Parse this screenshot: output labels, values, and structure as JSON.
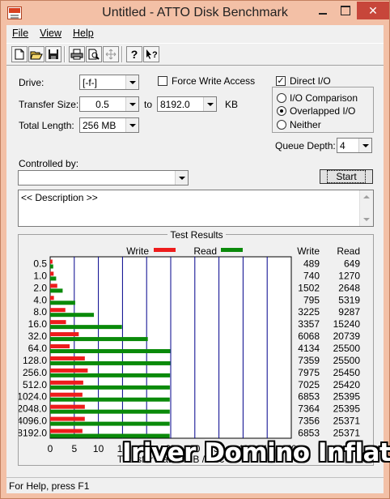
{
  "window": {
    "title": "Untitled - ATTO Disk Benchmark",
    "close_glyph": "✕"
  },
  "menu": [
    "File",
    "View",
    "Help"
  ],
  "toolbar_icons": [
    "new-icon",
    "open-icon",
    "save-icon",
    "print-icon",
    "print-preview-icon",
    "move-icon",
    "help-icon",
    "context-help-icon"
  ],
  "settings": {
    "drive_label": "Drive:",
    "drive_value": "[-f-]",
    "force_write_label": "Force Write Access",
    "force_write_checked": false,
    "direct_io_label": "Direct I/O",
    "direct_io_checked": true,
    "transfer_size_label": "Transfer Size:",
    "transfer_from": "0.5",
    "to_label": "to",
    "transfer_to": "8192.0",
    "kb_label": "KB",
    "total_length_label": "Total Length:",
    "total_length_value": "256 MB",
    "io_comparison_label": "I/O Comparison",
    "overlapped_io_label": "Overlapped I/O",
    "neither_label": "Neither",
    "selected_mode": "Overlapped I/O",
    "queue_depth_label": "Queue Depth:",
    "queue_depth_value": "4",
    "controlled_by_label": "Controlled by:",
    "controlled_by_value": "",
    "start_label": "Start",
    "description": "<< Description >>"
  },
  "results": {
    "title": "Test Results",
    "write_legend": "Write",
    "read_legend": "Read",
    "write_col": "Write",
    "read_col": "Read",
    "write_color": "#ee1c1c",
    "read_color": "#0a8a0a",
    "grid_color": "#00008b"
  },
  "chart_data": {
    "type": "bar",
    "orientation": "horizontal",
    "xlabel": "Transfer Rate - MB / Sec",
    "xlim": [
      0,
      50
    ],
    "xticks": [
      0,
      5,
      10,
      15,
      20,
      25,
      30,
      35,
      40,
      45,
      50
    ],
    "categories": [
      "0.5",
      "1.0",
      "2.0",
      "4.0",
      "8.0",
      "16.0",
      "32.0",
      "64.0",
      "128.0",
      "256.0",
      "512.0",
      "1024.0",
      "2048.0",
      "4096.0",
      "8192.0"
    ],
    "series": [
      {
        "name": "Write",
        "values": [
          0.48,
          0.72,
          1.47,
          0.78,
          3.15,
          3.28,
          5.93,
          4.04,
          7.19,
          7.79,
          6.86,
          6.69,
          7.19,
          7.18,
          6.69
        ]
      },
      {
        "name": "Read",
        "values": [
          0.63,
          1.24,
          2.59,
          5.19,
          9.07,
          14.88,
          20.25,
          24.9,
          24.9,
          24.85,
          24.82,
          24.8,
          24.8,
          24.78,
          24.78
        ]
      }
    ],
    "table": {
      "write": [
        "489",
        "740",
        "1502",
        "795",
        "3225",
        "3357",
        "6068",
        "4134",
        "7359",
        "7975",
        "7025",
        "6853",
        "7364",
        "7356",
        "6853"
      ],
      "read": [
        "649",
        "1270",
        "2648",
        "5319",
        "9287",
        "15240",
        "20739",
        "25500",
        "25500",
        "25450",
        "25420",
        "25395",
        "25395",
        "25371",
        "25371"
      ]
    }
  },
  "status_text": "For Help, press F1",
  "watermark": "Iriver Domino Inflate"
}
